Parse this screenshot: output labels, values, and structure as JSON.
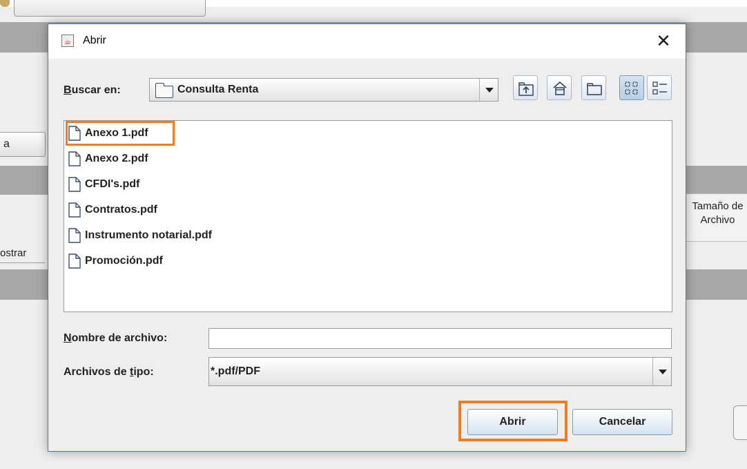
{
  "background": {
    "left_button_label": "a",
    "column_header_line1": "Tamaño de",
    "column_header_line2": "Archivo",
    "mostrar_label": "ostrar"
  },
  "dialog": {
    "title": "Abrir",
    "close_glyph": "✕",
    "look_in": {
      "label_first": "B",
      "label_rest": "uscar en:",
      "current_folder": "Consulta Renta"
    },
    "toolbar": {
      "icons": [
        "up-one-level-icon",
        "home-icon",
        "new-folder-icon",
        "list-view-icon",
        "details-view-icon"
      ]
    },
    "files": [
      {
        "name": "Anexo 1.pdf",
        "highlighted": true
      },
      {
        "name": "Anexo 2.pdf"
      },
      {
        "name": "CFDI's.pdf"
      },
      {
        "name": "Contratos.pdf"
      },
      {
        "name": "Instrumento notarial.pdf"
      },
      {
        "name": "Promoción.pdf"
      }
    ],
    "filename": {
      "label_first": "N",
      "label_rest": "ombre de archivo:",
      "value": ""
    },
    "filetype": {
      "label_before": "Archivos de ",
      "label_underlined": "t",
      "label_after": "ipo:",
      "selected": "*.pdf/PDF"
    },
    "buttons": {
      "open": "Abrir",
      "cancel": "Cancelar"
    },
    "accent_color": "#f47c20"
  }
}
